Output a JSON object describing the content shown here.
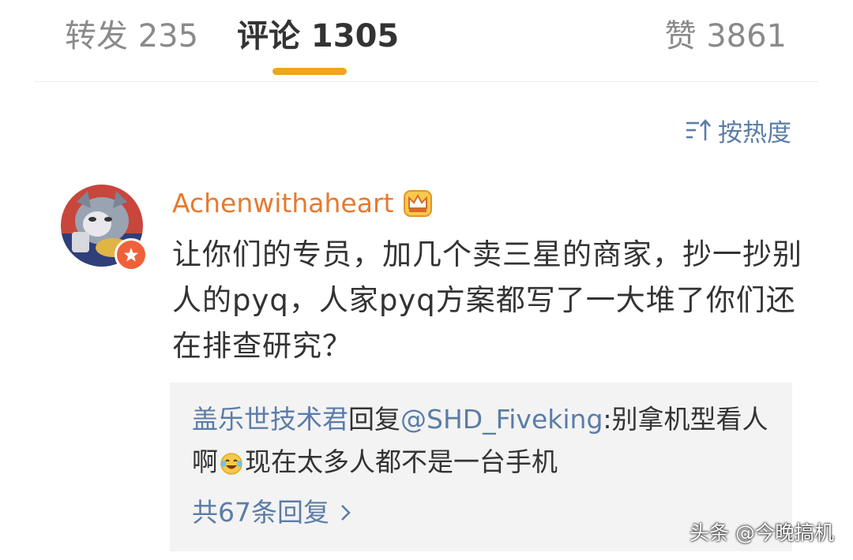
{
  "tabs": {
    "repost": "转发 235",
    "comment": "评论 1305",
    "like": "赞 3861"
  },
  "sort": {
    "label": "按热度",
    "icon": "sort-icon"
  },
  "comment": {
    "username": "Achenwithaheart",
    "text": "让你们的专员，加几个卖三星的商家，抄一抄别人的pyq，人家pyq方案都写了一大堆了你们还在排查研究？",
    "badges": [
      "verified-badge-icon",
      "crown-icon"
    ]
  },
  "reply": {
    "author": "盖乐世技术君",
    "action": "回复",
    "mention": "@SHD_Fiveking",
    "text_before_emoji": ":别拿机型看人啊",
    "emoji": "laugh-cry-emoji-icon",
    "text_after_emoji": "现在太多人都不是一台手机",
    "more_link": "共67条回复"
  },
  "watermark": "头条 @今晚搞机",
  "colors": {
    "accent": "#f2a41c",
    "link": "#5b7da8",
    "username": "#e67a2e",
    "reply_bg": "#f3f3f3"
  }
}
